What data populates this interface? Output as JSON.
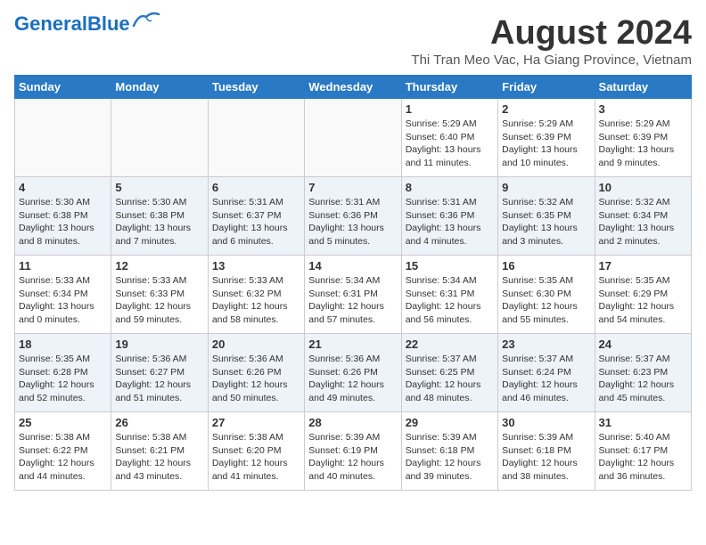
{
  "header": {
    "logo_general": "General",
    "logo_blue": "Blue",
    "title": "August 2024",
    "subtitle": "Thi Tran Meo Vac, Ha Giang Province, Vietnam"
  },
  "days_of_week": [
    "Sunday",
    "Monday",
    "Tuesday",
    "Wednesday",
    "Thursday",
    "Friday",
    "Saturday"
  ],
  "weeks": [
    [
      {
        "day": "",
        "info": ""
      },
      {
        "day": "",
        "info": ""
      },
      {
        "day": "",
        "info": ""
      },
      {
        "day": "",
        "info": ""
      },
      {
        "day": "1",
        "info": "Sunrise: 5:29 AM\nSunset: 6:40 PM\nDaylight: 13 hours\nand 11 minutes."
      },
      {
        "day": "2",
        "info": "Sunrise: 5:29 AM\nSunset: 6:39 PM\nDaylight: 13 hours\nand 10 minutes."
      },
      {
        "day": "3",
        "info": "Sunrise: 5:29 AM\nSunset: 6:39 PM\nDaylight: 13 hours\nand 9 minutes."
      }
    ],
    [
      {
        "day": "4",
        "info": "Sunrise: 5:30 AM\nSunset: 6:38 PM\nDaylight: 13 hours\nand 8 minutes."
      },
      {
        "day": "5",
        "info": "Sunrise: 5:30 AM\nSunset: 6:38 PM\nDaylight: 13 hours\nand 7 minutes."
      },
      {
        "day": "6",
        "info": "Sunrise: 5:31 AM\nSunset: 6:37 PM\nDaylight: 13 hours\nand 6 minutes."
      },
      {
        "day": "7",
        "info": "Sunrise: 5:31 AM\nSunset: 6:36 PM\nDaylight: 13 hours\nand 5 minutes."
      },
      {
        "day": "8",
        "info": "Sunrise: 5:31 AM\nSunset: 6:36 PM\nDaylight: 13 hours\nand 4 minutes."
      },
      {
        "day": "9",
        "info": "Sunrise: 5:32 AM\nSunset: 6:35 PM\nDaylight: 13 hours\nand 3 minutes."
      },
      {
        "day": "10",
        "info": "Sunrise: 5:32 AM\nSunset: 6:34 PM\nDaylight: 13 hours\nand 2 minutes."
      }
    ],
    [
      {
        "day": "11",
        "info": "Sunrise: 5:33 AM\nSunset: 6:34 PM\nDaylight: 13 hours\nand 0 minutes."
      },
      {
        "day": "12",
        "info": "Sunrise: 5:33 AM\nSunset: 6:33 PM\nDaylight: 12 hours\nand 59 minutes."
      },
      {
        "day": "13",
        "info": "Sunrise: 5:33 AM\nSunset: 6:32 PM\nDaylight: 12 hours\nand 58 minutes."
      },
      {
        "day": "14",
        "info": "Sunrise: 5:34 AM\nSunset: 6:31 PM\nDaylight: 12 hours\nand 57 minutes."
      },
      {
        "day": "15",
        "info": "Sunrise: 5:34 AM\nSunset: 6:31 PM\nDaylight: 12 hours\nand 56 minutes."
      },
      {
        "day": "16",
        "info": "Sunrise: 5:35 AM\nSunset: 6:30 PM\nDaylight: 12 hours\nand 55 minutes."
      },
      {
        "day": "17",
        "info": "Sunrise: 5:35 AM\nSunset: 6:29 PM\nDaylight: 12 hours\nand 54 minutes."
      }
    ],
    [
      {
        "day": "18",
        "info": "Sunrise: 5:35 AM\nSunset: 6:28 PM\nDaylight: 12 hours\nand 52 minutes."
      },
      {
        "day": "19",
        "info": "Sunrise: 5:36 AM\nSunset: 6:27 PM\nDaylight: 12 hours\nand 51 minutes."
      },
      {
        "day": "20",
        "info": "Sunrise: 5:36 AM\nSunset: 6:26 PM\nDaylight: 12 hours\nand 50 minutes."
      },
      {
        "day": "21",
        "info": "Sunrise: 5:36 AM\nSunset: 6:26 PM\nDaylight: 12 hours\nand 49 minutes."
      },
      {
        "day": "22",
        "info": "Sunrise: 5:37 AM\nSunset: 6:25 PM\nDaylight: 12 hours\nand 48 minutes."
      },
      {
        "day": "23",
        "info": "Sunrise: 5:37 AM\nSunset: 6:24 PM\nDaylight: 12 hours\nand 46 minutes."
      },
      {
        "day": "24",
        "info": "Sunrise: 5:37 AM\nSunset: 6:23 PM\nDaylight: 12 hours\nand 45 minutes."
      }
    ],
    [
      {
        "day": "25",
        "info": "Sunrise: 5:38 AM\nSunset: 6:22 PM\nDaylight: 12 hours\nand 44 minutes."
      },
      {
        "day": "26",
        "info": "Sunrise: 5:38 AM\nSunset: 6:21 PM\nDaylight: 12 hours\nand 43 minutes."
      },
      {
        "day": "27",
        "info": "Sunrise: 5:38 AM\nSunset: 6:20 PM\nDaylight: 12 hours\nand 41 minutes."
      },
      {
        "day": "28",
        "info": "Sunrise: 5:39 AM\nSunset: 6:19 PM\nDaylight: 12 hours\nand 40 minutes."
      },
      {
        "day": "29",
        "info": "Sunrise: 5:39 AM\nSunset: 6:18 PM\nDaylight: 12 hours\nand 39 minutes."
      },
      {
        "day": "30",
        "info": "Sunrise: 5:39 AM\nSunset: 6:18 PM\nDaylight: 12 hours\nand 38 minutes."
      },
      {
        "day": "31",
        "info": "Sunrise: 5:40 AM\nSunset: 6:17 PM\nDaylight: 12 hours\nand 36 minutes."
      }
    ]
  ]
}
